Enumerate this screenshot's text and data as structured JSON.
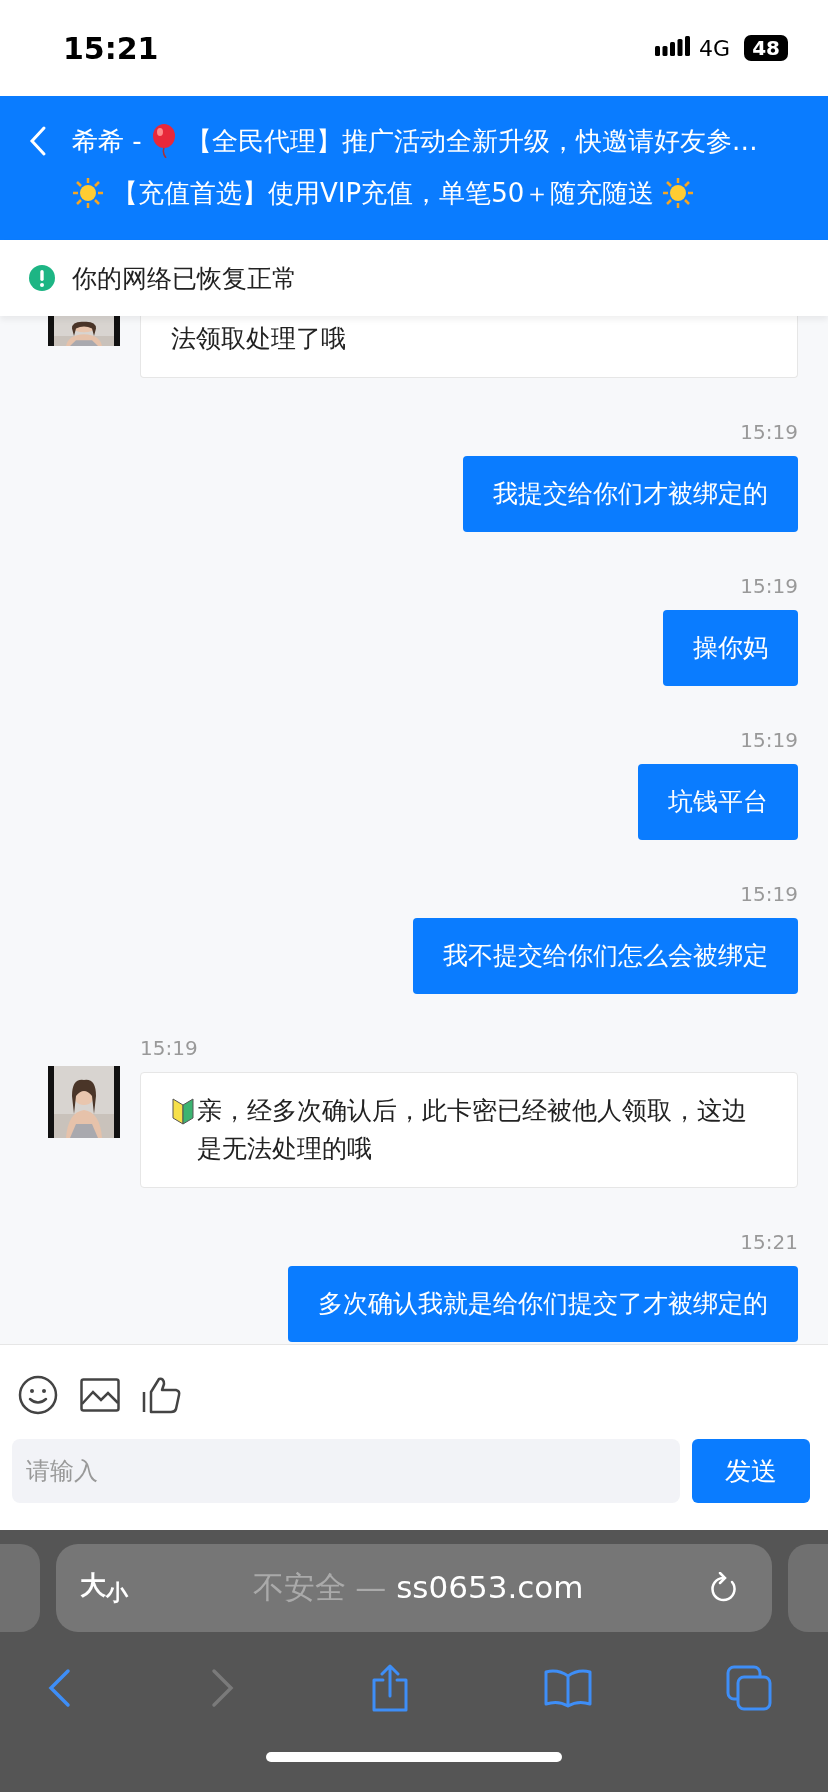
{
  "status_bar": {
    "time": "15:21",
    "network": "4G",
    "battery": "48"
  },
  "header": {
    "contact": "希希 -",
    "notice": "【全民代理】推广活动全新升级，快邀请好友参…",
    "promo": "【充值首选】使用VIP充值，单笔50＋随充随送"
  },
  "network_banner": {
    "text": "你的网络已恢复正常"
  },
  "messages": [
    {
      "kind": "received",
      "partial": true,
      "text": "法领取处理了哦",
      "marked": false
    },
    {
      "kind": "sent",
      "partial": false,
      "time": "15:19",
      "text": "我提交给你们才被绑定的",
      "marked": false
    },
    {
      "kind": "sent",
      "partial": false,
      "time": "15:19",
      "text": "操你妈",
      "marked": false
    },
    {
      "kind": "sent",
      "partial": false,
      "time": "15:19",
      "text": "坑钱平台",
      "marked": false
    },
    {
      "kind": "sent",
      "partial": false,
      "time": "15:19",
      "text": "我不提交给你们怎么会被绑定",
      "marked": false
    },
    {
      "kind": "received",
      "partial": false,
      "time": "15:19",
      "text": "亲，经多次确认后，此卡密已经被他人领取，这边是无法处理的哦",
      "marked": true
    },
    {
      "kind": "sent",
      "partial": false,
      "time": "15:21",
      "text": "多次确认我就是给你们提交了才被绑定的",
      "marked": false
    }
  ],
  "composer": {
    "placeholder": "请输入",
    "send": "发送"
  },
  "browser": {
    "text_size": "大$_{小}$",
    "security": "不安全 —",
    "domain": "ss0653.com"
  }
}
